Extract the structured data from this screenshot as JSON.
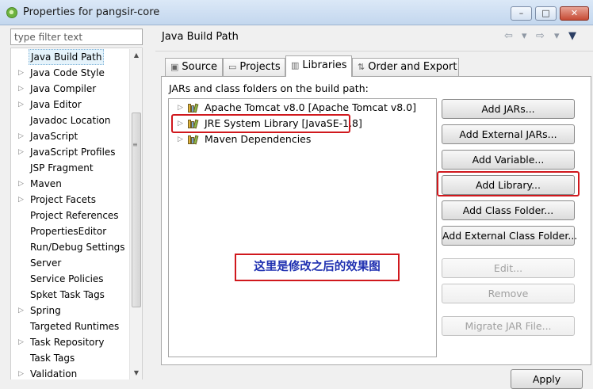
{
  "window": {
    "title": "Properties for pangsir-core",
    "min": "–",
    "max": "□",
    "close": "✕"
  },
  "filter": {
    "placeholder": "type filter text"
  },
  "sidebar": {
    "items": [
      {
        "label": "Java Build Path",
        "arrow": ""
      },
      {
        "label": "Java Code Style",
        "arrow": "▷"
      },
      {
        "label": "Java Compiler",
        "arrow": "▷"
      },
      {
        "label": "Java Editor",
        "arrow": "▷"
      },
      {
        "label": "Javadoc Location",
        "arrow": ""
      },
      {
        "label": "JavaScript",
        "arrow": "▷"
      },
      {
        "label": "JavaScript Profiles",
        "arrow": "▷"
      },
      {
        "label": "JSP Fragment",
        "arrow": ""
      },
      {
        "label": "Maven",
        "arrow": "▷"
      },
      {
        "label": "Project Facets",
        "arrow": "▷"
      },
      {
        "label": "Project References",
        "arrow": ""
      },
      {
        "label": "PropertiesEditor",
        "arrow": ""
      },
      {
        "label": "Run/Debug Settings",
        "arrow": ""
      },
      {
        "label": "Server",
        "arrow": ""
      },
      {
        "label": "Service Policies",
        "arrow": ""
      },
      {
        "label": "Spket Task Tags",
        "arrow": ""
      },
      {
        "label": "Spring",
        "arrow": "▷"
      },
      {
        "label": "Targeted Runtimes",
        "arrow": ""
      },
      {
        "label": "Task Repository",
        "arrow": "▷"
      },
      {
        "label": "Task Tags",
        "arrow": ""
      },
      {
        "label": "Validation",
        "arrow": "▷"
      }
    ],
    "scroll_up": "▲",
    "scroll_down": "▼",
    "grip": "≡"
  },
  "page": {
    "title": "Java Build Path",
    "back": "⇦",
    "dropdown": "▾",
    "forward": "⇨",
    "menu": "▼"
  },
  "tabs": [
    {
      "label": "Source",
      "icon": "▣"
    },
    {
      "label": "Projects",
      "icon": "▭"
    },
    {
      "label": "Libraries",
      "icon": "▥"
    },
    {
      "label": "Order and Export",
      "icon": "⇅"
    }
  ],
  "libraries": {
    "heading": "JARs and class folders on the build path:",
    "items": [
      {
        "label": "Apache Tomcat v8.0 [Apache Tomcat v8.0]",
        "arrow": "▷"
      },
      {
        "label": "JRE System Library [JavaSE-1.8]",
        "arrow": "▷"
      },
      {
        "label": "Maven Dependencies",
        "arrow": "▷"
      }
    ]
  },
  "buttons": {
    "add_jars": "Add JARs...",
    "add_external_jars": "Add External JARs...",
    "add_variable": "Add Variable...",
    "add_library": "Add Library...",
    "add_class_folder": "Add Class Folder...",
    "add_external_class_folder": "Add External Class Folder...",
    "edit": "Edit...",
    "remove": "Remove",
    "migrate": "Migrate JAR File...",
    "apply": "Apply"
  },
  "annotation": "这里是修改之后的效果图",
  "colors": {
    "highlight": "#d0181d",
    "annotation_text": "#1e2fb0",
    "selection": "#e5f3fb"
  }
}
